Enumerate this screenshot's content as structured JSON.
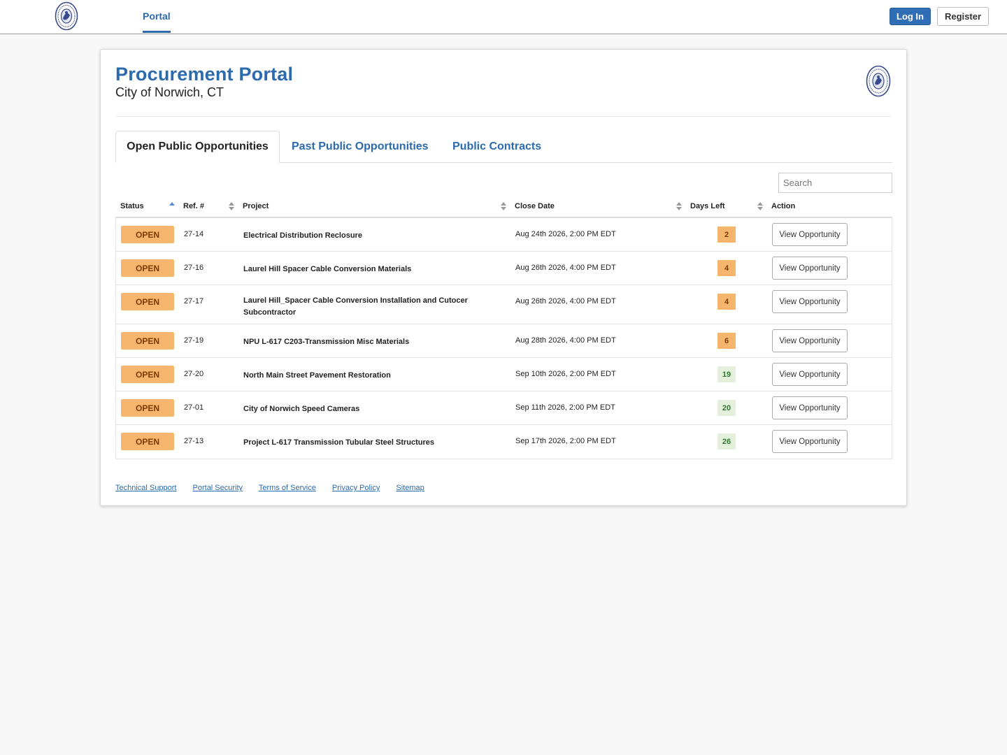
{
  "topbar": {
    "nav_portal": "Portal",
    "login_label": "Log In",
    "register_label": "Register"
  },
  "header": {
    "title": "Procurement Portal",
    "subtitle": "City of Norwich, CT"
  },
  "tabs": [
    {
      "label": "Open Public Opportunities",
      "active": true
    },
    {
      "label": "Past Public Opportunities",
      "active": false
    },
    {
      "label": "Public Contracts",
      "active": false
    }
  ],
  "search": {
    "placeholder": "Search",
    "value": ""
  },
  "table": {
    "columns": [
      "Status",
      "Ref. #",
      "Project",
      "Close Date",
      "Days Left",
      "Action"
    ],
    "rows": [
      {
        "status": "OPEN",
        "ref": "27-14",
        "project": "Electrical Distribution Reclosure",
        "close_date": "Aug 24th 2026, 2:00 PM EDT",
        "days_left": "2",
        "days_level": "warn",
        "action": "View Opportunity"
      },
      {
        "status": "OPEN",
        "ref": "27-16",
        "project": "Laurel Hill Spacer Cable Conversion Materials",
        "close_date": "Aug 26th 2026, 4:00 PM EDT",
        "days_left": "4",
        "days_level": "warn",
        "action": "View Opportunity"
      },
      {
        "status": "OPEN",
        "ref": "27-17",
        "project": "Laurel Hill_Spacer Cable Conversion Installation and Cutocer Subcontractor",
        "close_date": "Aug 26th 2026, 4:00 PM EDT",
        "days_left": "4",
        "days_level": "warn",
        "action": "View Opportunity"
      },
      {
        "status": "OPEN",
        "ref": "27-19",
        "project": "NPU L-617 C203-Transmission Misc Materials",
        "close_date": "Aug 28th 2026, 4:00 PM EDT",
        "days_left": "6",
        "days_level": "warn",
        "action": "View Opportunity"
      },
      {
        "status": "OPEN",
        "ref": "27-20",
        "project": "North Main Street Pavement Restoration",
        "close_date": "Sep 10th 2026, 2:00 PM EDT",
        "days_left": "19",
        "days_level": "ok",
        "action": "View Opportunity"
      },
      {
        "status": "OPEN",
        "ref": "27-01",
        "project": "City of Norwich Speed Cameras",
        "close_date": "Sep 11th 2026, 2:00 PM EDT",
        "days_left": "20",
        "days_level": "ok",
        "action": "View Opportunity"
      },
      {
        "status": "OPEN",
        "ref": "27-13",
        "project": "Project L-617 Transmission Tubular Steel Structures",
        "close_date": "Sep 17th 2026, 2:00 PM EDT",
        "days_left": "26",
        "days_level": "ok",
        "action": "View Opportunity"
      }
    ]
  },
  "footer": {
    "links": [
      "Technical Support",
      "Portal Security",
      "Terms of Service",
      "Privacy Policy",
      "Sitemap"
    ]
  },
  "colors": {
    "brand_blue": "#2b6aad",
    "status_open": "#f6b56c",
    "days_ok_bg": "#e4f0dc"
  },
  "icons": {
    "logo": "city-seal-icon",
    "sort": "sort-icon"
  }
}
